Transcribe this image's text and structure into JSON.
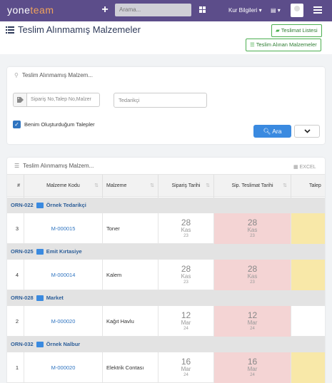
{
  "topbar": {
    "logo_main": "yone",
    "logo_accent": "team",
    "plus": "+",
    "search_placeholder": "Arama...",
    "kur_label": "Kur Bilgileri ▾",
    "flag_label": "▤ ▾",
    "colors": {
      "bar": "#5c4d8a",
      "accent": "#f0a25c"
    }
  },
  "header": {
    "title": "Teslim Alınmamış Malzemeler",
    "btn_teslimat": "Teslimat Listesi",
    "btn_alinan": "Teslim Alınan Malzemeler"
  },
  "filter": {
    "title": "Teslim Alınmamış Malzem...",
    "order_placeholder": "Sipariş No,Talep No,Malzer",
    "supplier_placeholder": "Tedarikçi",
    "checkbox_label": "Benim Oluşturduğum Talepler",
    "checkbox_checked": true,
    "search_button": "Ara"
  },
  "table": {
    "title": "Teslim Alınmamış Malzem...",
    "excel_label": "EXCEL",
    "columns": [
      "#",
      "Malzeme Kodu",
      "Malzeme",
      "Sipariş Tarihi",
      "Sip. Teslimat Tarihi",
      "Talep"
    ],
    "groups": [
      {
        "order": "ORN-022",
        "supplier": "Örnek Tedarikçi",
        "row": {
          "no": "3",
          "code": "M-000015",
          "name": "Toner",
          "order_date": {
            "day": "28",
            "month": "Kas",
            "year": "23"
          },
          "delivery_date": {
            "day": "28",
            "month": "Kas",
            "year": "23"
          },
          "talep_highlight": true
        }
      },
      {
        "order": "ORN-025",
        "supplier": "Emit Kırtasiye",
        "row": {
          "no": "4",
          "code": "M-000014",
          "name": "Kalem",
          "order_date": {
            "day": "28",
            "month": "Kas",
            "year": "23"
          },
          "delivery_date": {
            "day": "28",
            "month": "Kas",
            "year": "23"
          },
          "talep_highlight": true
        }
      },
      {
        "order": "ORN-028",
        "supplier": "Market",
        "row": {
          "no": "2",
          "code": "M-000020",
          "name": "Kağıt Havlu",
          "order_date": {
            "day": "12",
            "month": "Mar",
            "year": "24"
          },
          "delivery_date": {
            "day": "12",
            "month": "Mar",
            "year": "24"
          },
          "talep_highlight": false
        }
      },
      {
        "order": "ORN-032",
        "supplier": "Örnek Nalbur",
        "row": {
          "no": "1",
          "code": "M-000020",
          "name": "Elektrik Contası",
          "order_date": {
            "day": "16",
            "month": "Mar",
            "year": "24"
          },
          "delivery_date": {
            "day": "16",
            "month": "Mar",
            "year": "24"
          },
          "talep_highlight": true
        }
      }
    ]
  }
}
